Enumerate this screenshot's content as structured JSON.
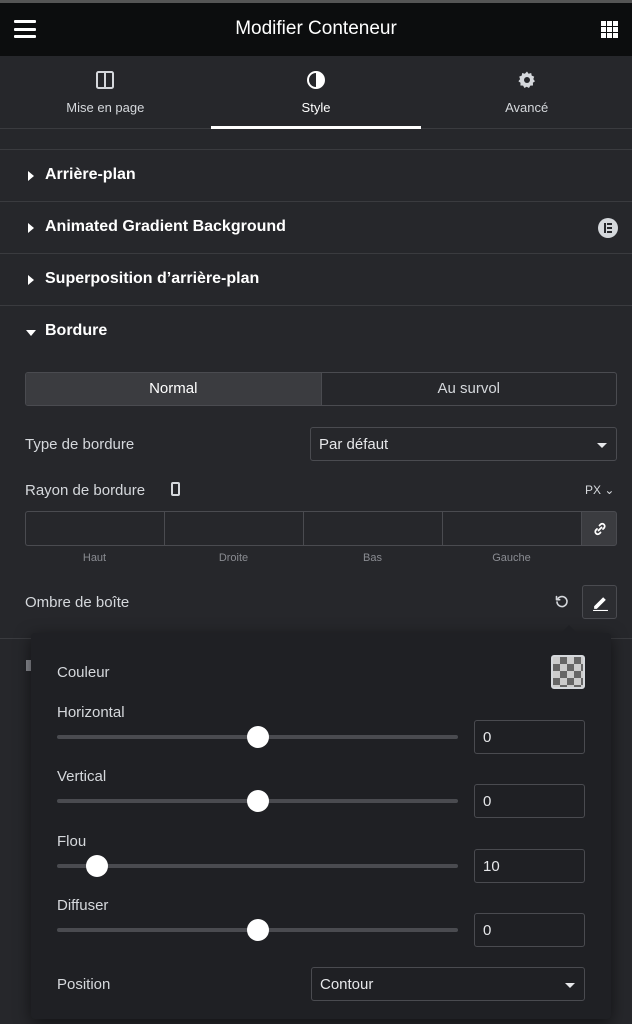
{
  "header": {
    "title": "Modifier Conteneur",
    "menu_icon": "hamburger-icon",
    "apps_icon": "grid-icon"
  },
  "tabs": [
    {
      "label": "Mise en page",
      "icon": "layout-columns-icon"
    },
    {
      "label": "Style",
      "icon": "half-circle-icon",
      "active": true
    },
    {
      "label": "Avancé",
      "icon": "gear-icon"
    }
  ],
  "sections": [
    {
      "title": "Arrière-plan",
      "expanded": false
    },
    {
      "title": "Animated Gradient Background",
      "expanded": false,
      "badge_icon": "elementor-badge-icon"
    },
    {
      "title": "Superposition d’arrière-plan",
      "expanded": false
    },
    {
      "title": "Bordure",
      "expanded": true
    }
  ],
  "border": {
    "state_tabs": {
      "normal": "Normal",
      "hover": "Au survol",
      "active": "normal"
    },
    "type_label": "Type de bordure",
    "type_value": "Par défaut",
    "radius_label": "Rayon de bordure",
    "radius_unit": "PX",
    "radius_fields": {
      "top": "Haut",
      "right": "Droite",
      "bottom": "Bas",
      "left": "Gauche"
    },
    "shadow_label": "Ombre de boîte"
  },
  "shadow_popover": {
    "color_label": "Couleur",
    "horizontal": {
      "label": "Horizontal",
      "value": "0",
      "slider_fraction": 0.5
    },
    "vertical": {
      "label": "Vertical",
      "value": "0",
      "slider_fraction": 0.5
    },
    "blur": {
      "label": "Flou",
      "value": "10",
      "slider_fraction": 0.1
    },
    "spread": {
      "label": "Diffuser",
      "value": "0",
      "slider_fraction": 0.5
    },
    "position_label": "Position",
    "position_value": "Contour"
  },
  "colors": {
    "header_bg": "#0c0d0e",
    "panel_bg": "#26272b",
    "popover_bg": "#1f2024",
    "text": "#d5d8dc"
  }
}
